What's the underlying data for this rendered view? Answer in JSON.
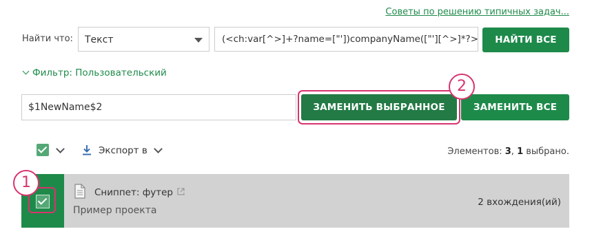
{
  "header": {
    "tips_link": "Советы по решению типичных задач..."
  },
  "search": {
    "find_label": "Найти что:",
    "mode_value": "Текст",
    "regex_value": "(<ch:var[^>]+?name=[\"'])companyName([\"'][^>]*?>)",
    "find_all_button": "НАЙТИ ВСЕ"
  },
  "filter": {
    "label": "Фильтр: Пользовательский"
  },
  "replace": {
    "value": "$1NewName$2",
    "replace_selected_button": "ЗАМЕНИТЬ ВЫБРАННОЕ",
    "replace_all_button": "ЗАМЕНИТЬ ВСЕ"
  },
  "callouts": {
    "one": "1",
    "two": "2"
  },
  "toolbar": {
    "export_label": "Экспорт в",
    "count_prefix": "Элементов: ",
    "count_total": "3",
    "count_sep": ", ",
    "count_selected": "1",
    "count_suffix": " выбрано."
  },
  "results": [
    {
      "title": "Сниппет: футер",
      "project": "Пример проекта",
      "occurrences": "2 вхождения(ий)"
    }
  ],
  "colors": {
    "accent": "#1e8a4a",
    "highlight": "#d8336e",
    "row_bg": "#d2d2d2"
  },
  "icons": [
    "chevron-down-icon",
    "checkbox-icon",
    "download-icon",
    "document-icon",
    "external-link-icon"
  ]
}
